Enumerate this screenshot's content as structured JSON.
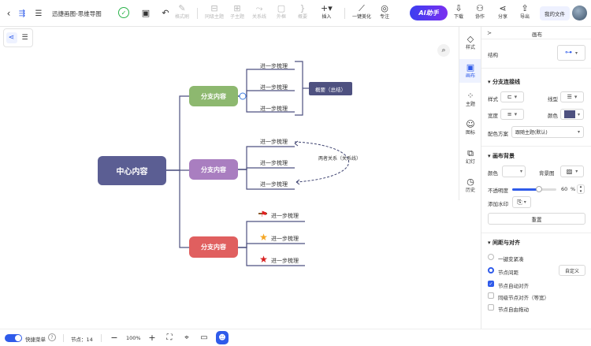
{
  "header": {
    "title": "迅捷画图-思维导图",
    "tools": [
      {
        "name": "format-painter",
        "label": "格式刷"
      },
      {
        "name": "sibling-topic",
        "label": "同级主题"
      },
      {
        "name": "child-topic",
        "label": "子主题"
      },
      {
        "name": "relation",
        "label": "关系线"
      },
      {
        "name": "outline",
        "label": "外框"
      },
      {
        "name": "summary",
        "label": "概要"
      },
      {
        "name": "insert",
        "label": "插入"
      },
      {
        "name": "beautify",
        "label": "一键美化"
      },
      {
        "name": "focus",
        "label": "专注"
      }
    ],
    "ai_label": "AI助手",
    "right_tools": [
      {
        "name": "download",
        "label": "下载"
      },
      {
        "name": "collab",
        "label": "协作"
      },
      {
        "name": "share",
        "label": "分享"
      },
      {
        "name": "export",
        "label": "导出"
      }
    ],
    "my_files": "我的文件"
  },
  "mindmap": {
    "root": "中心内容",
    "branches": [
      {
        "label": "分支内容",
        "color": "#8db86f",
        "leaves": [
          "进一步梳理",
          "进一步梳理",
          "进一步梳理"
        ]
      },
      {
        "label": "分支内容",
        "color": "#a97ec0",
        "leaves": [
          "进一步梳理",
          "进一步梳理",
          "进一步梳理"
        ]
      },
      {
        "label": "分支内容",
        "color": "#e05f5f",
        "leaves": [
          "进一步梳理",
          "进一步梳理",
          "进一步梳理"
        ]
      }
    ],
    "summary_label": "概要（总结）",
    "relation_label": "两者关系（关系线）",
    "root_color": "#5b5e93",
    "summary_color": "#4e5180"
  },
  "rail": [
    {
      "name": "style",
      "label": "样式"
    },
    {
      "name": "canvas",
      "label": "画布"
    },
    {
      "name": "theme",
      "label": "主题"
    },
    {
      "name": "icon",
      "label": "图标"
    },
    {
      "name": "slides",
      "label": "幻灯"
    },
    {
      "name": "history",
      "label": "历史"
    }
  ],
  "panel": {
    "title": "画布",
    "structure_label": "结构",
    "branch_section": "分支连接线",
    "style_label": "样式",
    "line_type_label": "线型",
    "width_label": "宽度",
    "color_label": "颜色",
    "scheme_label": "配色方案",
    "scheme_value": "跟随主题(默认)",
    "bg_section": "画布背景",
    "bg_color_label": "颜色",
    "bg_image_label": "背景图",
    "opacity_label": "不透明度",
    "opacity_value": "60",
    "opacity_unit": "%",
    "opacity_fraction": 0.6,
    "watermark_label": "添加水印",
    "reset_label": "重置",
    "spacing_section": "间距与对齐",
    "compact_label": "一键变紧凑",
    "node_spacing_label": "节点间距",
    "custom_label": "自定义",
    "auto_align_label": "节点自动对齐",
    "same_level_label": "同级节点对齐（等宽）",
    "free_drag_label": "节点自由拖动"
  },
  "bottom": {
    "quick_menu": "快捷菜单",
    "node_count": "节点：14",
    "zoom": "100%"
  },
  "colors": {
    "accent": "#2f5bea",
    "ai": "#4a3df0"
  }
}
